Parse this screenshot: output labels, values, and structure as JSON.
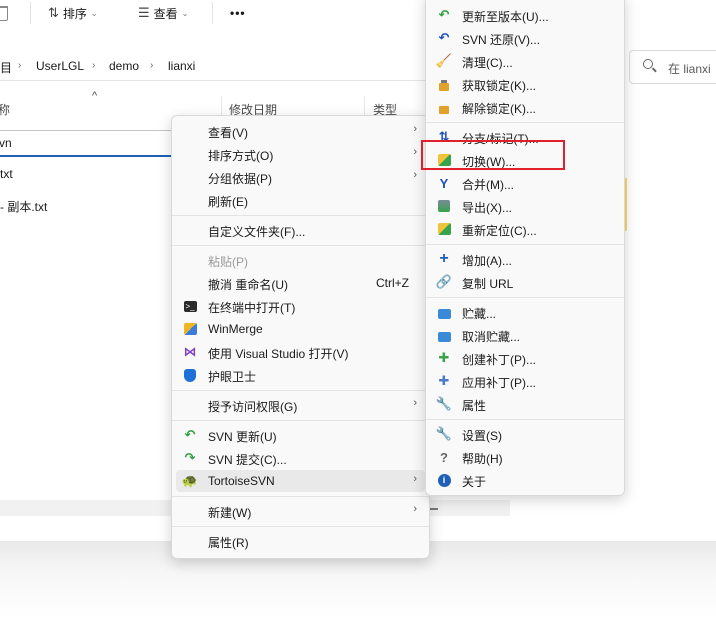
{
  "toolbar": {
    "sort_label": "排序",
    "view_label": "查看",
    "more_label": "•••"
  },
  "address": {
    "crumbs": [
      "目",
      "UserLGL",
      "demo",
      "lianxi"
    ],
    "search_placeholder": "在 lianxi"
  },
  "columns": {
    "name": "称",
    "modified": "修改日期",
    "type": "类型"
  },
  "files": [
    {
      "name": "vn"
    },
    {
      "name": "txt"
    },
    {
      "name": "- 副本.txt"
    }
  ],
  "context_menu": {
    "view": "查看(V)",
    "sort": "排序方式(O)",
    "group": "分组依据(P)",
    "refresh": "刷新(E)",
    "customize": "自定义文件夹(F)...",
    "paste": "粘贴(P)",
    "undo": "撤消 重命名(U)",
    "undo_shortcut": "Ctrl+Z",
    "terminal": "在终端中打开(T)",
    "winmerge": "WinMerge",
    "visual_studio": "使用 Visual Studio 打开(V)",
    "eye_guard": "护眼卫士",
    "access": "授予访问权限(G)",
    "svn_update": "SVN 更新(U)",
    "svn_commit": "SVN 提交(C)...",
    "tortoise": "TortoiseSVN",
    "new": "新建(W)",
    "properties": "属性(R)"
  },
  "svn_menu": {
    "update_rev": "更新至版本(U)...",
    "revert": "SVN 还原(V)...",
    "cleanup": "清理(C)...",
    "get_lock": "获取锁定(K)...",
    "release_lock": "解除锁定(K)...",
    "branch_tag": "分支/标记(T)...",
    "switch": "切换(W)...",
    "merge": "合并(M)...",
    "export": "导出(X)...",
    "relocate": "重新定位(C)...",
    "add": "增加(A)...",
    "copy_url": "复制 URL",
    "shelve": "贮藏...",
    "unshelve": "取消贮藏...",
    "create_patch": "创建补丁(P)...",
    "apply_patch": "应用补丁(P)...",
    "props": "属性",
    "settings": "设置(S)",
    "help": "帮助(H)",
    "about": "关于"
  },
  "colors": {
    "highlight_box": "#e0202a",
    "accent": "#1f5fb7"
  }
}
